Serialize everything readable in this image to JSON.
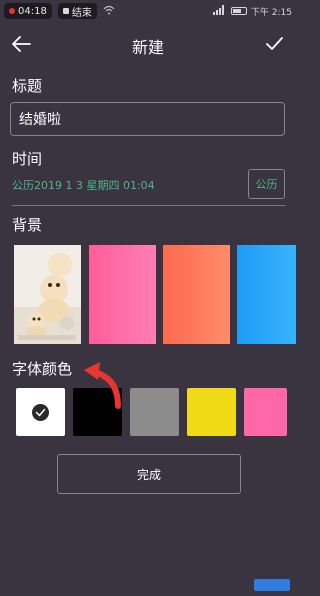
{
  "status_bar": {
    "record_time": "04:18",
    "end_label": "结束",
    "right_text": "下午 2:15"
  },
  "header": {
    "title": "新建",
    "back_icon": "arrow-left-icon",
    "confirm_icon": "check-icon"
  },
  "title_section": {
    "label": "标题",
    "input_value": "结婚啦"
  },
  "time_section": {
    "label": "时间",
    "date_value": "公历2019 1 3 星期四 01:04",
    "calendar_toggle": "公历"
  },
  "background_section": {
    "label": "背景",
    "options": [
      {
        "kind": "photo",
        "name": "dog-photo"
      },
      {
        "kind": "color",
        "color": "#ff6fa8"
      },
      {
        "kind": "color",
        "color": "#ff7a5c"
      },
      {
        "kind": "color",
        "color": "#2aa8ff"
      }
    ]
  },
  "font_color_section": {
    "label": "字体颜色",
    "swatches": [
      "#ffffff",
      "#000000",
      "#8c8c8c",
      "#f0da16",
      "#ff68a8"
    ],
    "selected_index": 0
  },
  "done_button": "完成",
  "colors": {
    "background": "#3a3340",
    "accent_green": "#4fb58e",
    "annotation_arrow": "#e8352f"
  }
}
